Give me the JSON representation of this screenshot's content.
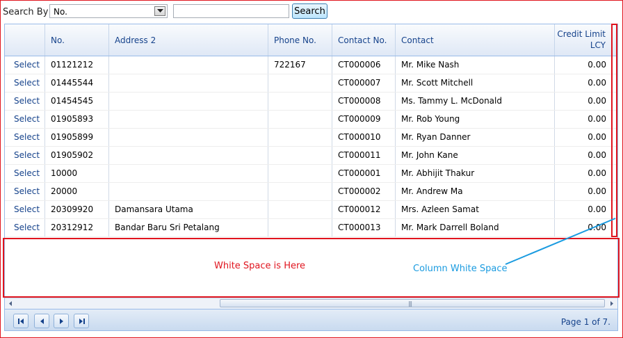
{
  "search": {
    "label": "Search By",
    "selected": "No.",
    "input_value": "",
    "button_label": "Search"
  },
  "grid": {
    "columns": [
      "",
      "No.",
      "Address 2",
      "Phone No.",
      "Contact No.",
      "Contact",
      "Credit Limit LCY"
    ],
    "rows": [
      {
        "select": "Select",
        "no": "01121212",
        "address2": "",
        "phone": "722167",
        "contact_no": "CT000006",
        "contact": "Mr. Mike Nash",
        "credit": "0.00"
      },
      {
        "select": "Select",
        "no": "01445544",
        "address2": "",
        "phone": "",
        "contact_no": "CT000007",
        "contact": "Mr. Scott Mitchell",
        "credit": "0.00"
      },
      {
        "select": "Select",
        "no": "01454545",
        "address2": "",
        "phone": "",
        "contact_no": "CT000008",
        "contact": "Ms. Tammy L. McDonald",
        "credit": "0.00"
      },
      {
        "select": "Select",
        "no": "01905893",
        "address2": "",
        "phone": "",
        "contact_no": "CT000009",
        "contact": "Mr. Rob Young",
        "credit": "0.00"
      },
      {
        "select": "Select",
        "no": "01905899",
        "address2": "",
        "phone": "",
        "contact_no": "CT000010",
        "contact": "Mr. Ryan Danner",
        "credit": "0.00"
      },
      {
        "select": "Select",
        "no": "01905902",
        "address2": "",
        "phone": "",
        "contact_no": "CT000011",
        "contact": "Mr. John Kane",
        "credit": "0.00"
      },
      {
        "select": "Select",
        "no": "10000",
        "address2": "",
        "phone": "",
        "contact_no": "CT000001",
        "contact": "Mr. Abhijit Thakur",
        "credit": "0.00"
      },
      {
        "select": "Select",
        "no": "20000",
        "address2": "",
        "phone": "",
        "contact_no": "CT000002",
        "contact": "Mr. Andrew Ma",
        "credit": "0.00"
      },
      {
        "select": "Select",
        "no": "20309920",
        "address2": "Damansara Utama",
        "phone": "",
        "contact_no": "CT000012",
        "contact": "Mrs. Azleen Samat",
        "credit": "0.00"
      },
      {
        "select": "Select",
        "no": "20312912",
        "address2": "Bandar Baru Sri Petalang",
        "phone": "",
        "contact_no": "CT000013",
        "contact": "Mr. Mark Darrell Boland",
        "credit": "0.00"
      }
    ]
  },
  "pager": {
    "info": "Page 1 of 7."
  },
  "annotations": {
    "white_space": "White Space is Here",
    "column_white_space": "Column White Space",
    "red": "#e0141e",
    "blue": "#1a9be0"
  }
}
